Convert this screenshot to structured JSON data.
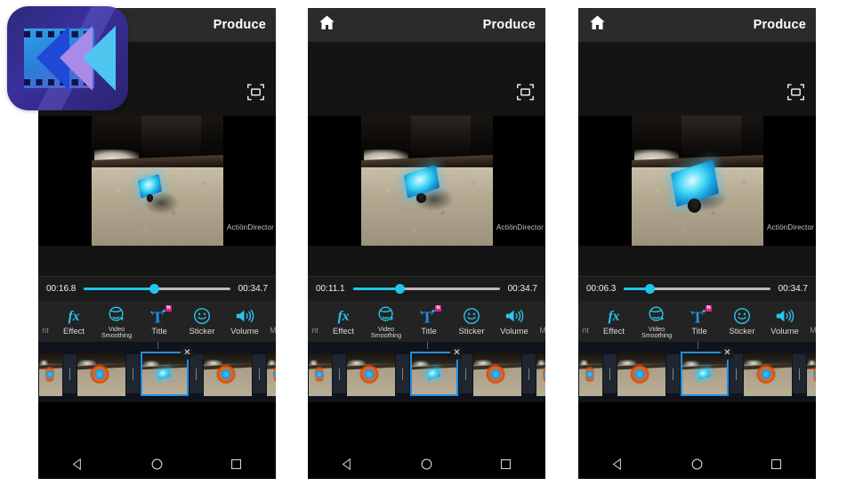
{
  "app": {
    "name": "ActionDirector",
    "icon_name": "actiondirector-app-icon",
    "watermark": "ActiönDirector"
  },
  "panels": [
    {
      "id": "panel-1",
      "appbar": {
        "home_icon": "home-icon",
        "title": "Produce",
        "home_visible": false
      },
      "preview": {
        "fullscreen_icon": "fullscreen-icon",
        "watermark": "ActiönDirector",
        "object_state": "small-glowing-toy-upright"
      },
      "seek": {
        "current_time": "00:16.8",
        "total_time": "00:34.7",
        "progress_percent": 48
      },
      "tools": [
        {
          "label": "nt",
          "icon": "adjustment-icon",
          "truncated": true
        },
        {
          "label": "Effect",
          "icon": "fx-icon",
          "badge": ""
        },
        {
          "label": "Video Smoothing",
          "icon": "video-smoothing-icon",
          "badge": ""
        },
        {
          "label": "Title",
          "icon": "title-icon",
          "badge": "N"
        },
        {
          "label": "Sticker",
          "icon": "sticker-icon",
          "badge": ""
        },
        {
          "label": "Volume",
          "icon": "volume-icon",
          "badge": ""
        },
        {
          "label": "M",
          "icon": "music-icon",
          "truncated": true
        }
      ],
      "timeline": {
        "clips": [
          {
            "type": "thumb",
            "kind": "half",
            "selected": false,
            "content": "firework"
          },
          {
            "type": "divider"
          },
          {
            "type": "thumb",
            "kind": "full",
            "selected": false,
            "content": "firework"
          },
          {
            "type": "divider"
          },
          {
            "type": "thumb",
            "kind": "full",
            "selected": true,
            "content": "glow-cube",
            "close_icon": "close-icon"
          },
          {
            "type": "divider"
          },
          {
            "type": "thumb",
            "kind": "full",
            "selected": false,
            "content": "firework"
          },
          {
            "type": "divider"
          },
          {
            "type": "thumb",
            "kind": "half",
            "selected": false,
            "content": "firework"
          }
        ]
      },
      "nav": {
        "back_icon": "back-triangle-icon",
        "home_icon": "home-circle-icon",
        "recents_icon": "recents-square-icon"
      }
    },
    {
      "id": "panel-2",
      "appbar": {
        "home_icon": "home-icon",
        "title": "Produce",
        "home_visible": true
      },
      "preview": {
        "fullscreen_icon": "fullscreen-icon",
        "watermark": "ActiönDirector",
        "object_state": "medium-glowing-cube"
      },
      "seek": {
        "current_time": "00:11.1",
        "total_time": "00:34.7",
        "progress_percent": 32
      },
      "tools": [
        {
          "label": "nt",
          "icon": "adjustment-icon",
          "truncated": true
        },
        {
          "label": "Effect",
          "icon": "fx-icon",
          "badge": ""
        },
        {
          "label": "Video Smoothing",
          "icon": "video-smoothing-icon",
          "badge": ""
        },
        {
          "label": "Title",
          "icon": "title-icon",
          "badge": "N"
        },
        {
          "label": "Sticker",
          "icon": "sticker-icon",
          "badge": ""
        },
        {
          "label": "Volume",
          "icon": "volume-icon",
          "badge": ""
        },
        {
          "label": "M",
          "icon": "music-icon",
          "truncated": true
        }
      ],
      "timeline": {
        "clips": [
          {
            "type": "thumb",
            "kind": "half",
            "selected": false,
            "content": "firework"
          },
          {
            "type": "divider"
          },
          {
            "type": "thumb",
            "kind": "full",
            "selected": false,
            "content": "firework"
          },
          {
            "type": "divider"
          },
          {
            "type": "thumb",
            "kind": "full",
            "selected": true,
            "content": "glow-cube",
            "close_icon": "close-icon"
          },
          {
            "type": "divider"
          },
          {
            "type": "thumb",
            "kind": "full",
            "selected": false,
            "content": "firework"
          },
          {
            "type": "divider"
          },
          {
            "type": "thumb",
            "kind": "half",
            "selected": false,
            "content": "firework"
          }
        ]
      },
      "nav": {
        "back_icon": "back-triangle-icon",
        "home_icon": "home-circle-icon",
        "recents_icon": "recents-square-icon"
      }
    },
    {
      "id": "panel-3",
      "appbar": {
        "home_icon": "home-icon",
        "title": "Produce",
        "home_visible": true
      },
      "preview": {
        "fullscreen_icon": "fullscreen-icon",
        "watermark": "ActiönDirector",
        "object_state": "large-glowing-cube"
      },
      "seek": {
        "current_time": "00:06.3",
        "total_time": "00:34.7",
        "progress_percent": 18
      },
      "tools": [
        {
          "label": "nt",
          "icon": "adjustment-icon",
          "truncated": true
        },
        {
          "label": "Effect",
          "icon": "fx-icon",
          "badge": ""
        },
        {
          "label": "Video Smoothing",
          "icon": "video-smoothing-icon",
          "badge": ""
        },
        {
          "label": "Title",
          "icon": "title-icon",
          "badge": "N"
        },
        {
          "label": "Sticker",
          "icon": "sticker-icon",
          "badge": ""
        },
        {
          "label": "Volume",
          "icon": "volume-icon",
          "badge": ""
        },
        {
          "label": "M",
          "icon": "music-icon",
          "truncated": true
        }
      ],
      "timeline": {
        "clips": [
          {
            "type": "thumb",
            "kind": "half",
            "selected": false,
            "content": "firework"
          },
          {
            "type": "divider"
          },
          {
            "type": "thumb",
            "kind": "full",
            "selected": false,
            "content": "firework"
          },
          {
            "type": "divider"
          },
          {
            "type": "thumb",
            "kind": "full",
            "selected": true,
            "content": "glow-cube",
            "close_icon": "close-icon"
          },
          {
            "type": "divider"
          },
          {
            "type": "thumb",
            "kind": "full",
            "selected": false,
            "content": "firework"
          },
          {
            "type": "divider"
          },
          {
            "type": "thumb",
            "kind": "half",
            "selected": false,
            "content": "firework"
          }
        ]
      },
      "nav": {
        "back_icon": "back-triangle-icon",
        "home_icon": "home-circle-icon",
        "recents_icon": "recents-square-icon"
      }
    }
  ],
  "colors": {
    "accent_cyan": "#20c5e8",
    "selection_blue": "#1f90e8",
    "badge_pink": "#e0218a",
    "appbar_bg": "#2b2b2b",
    "toolstrip_bg": "#232323",
    "timeline_bg": "#0e131c"
  }
}
